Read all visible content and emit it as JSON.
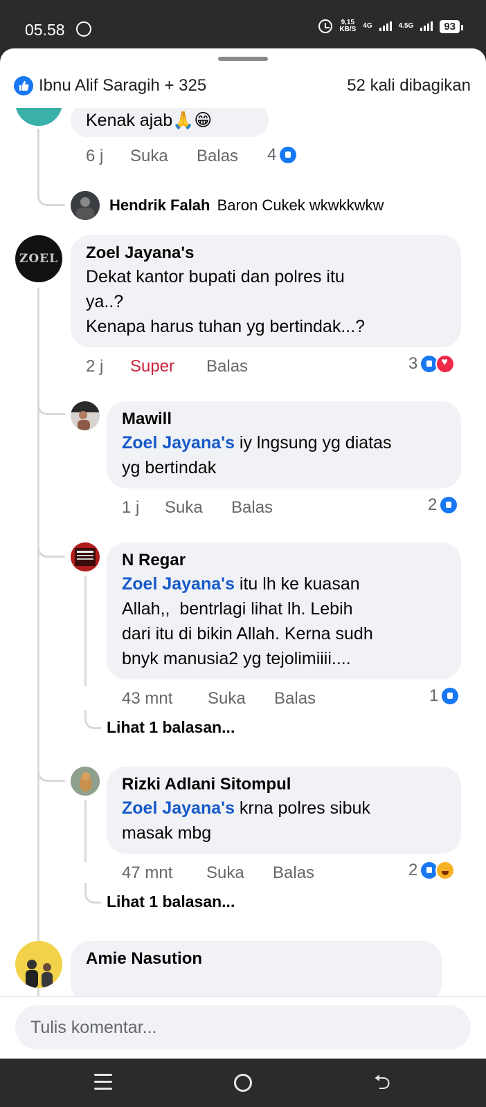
{
  "status_bar": {
    "time": "05.58",
    "net_speed_value": "9,15",
    "net_speed_unit": "KB/S",
    "sim1": "4G",
    "sim2": "4.5G",
    "battery": "93"
  },
  "sheet": {
    "reactors": "Ibnu Alif Saragih + 325",
    "shares": "52 kali dibagikan"
  },
  "comments": [
    {
      "id": "c0",
      "text": "Kenak ajab🙏😁",
      "time": "6 j",
      "like_label": "Suka",
      "reply_label": "Balas",
      "reaction_count": "4"
    },
    {
      "id": "c0-reply",
      "author": "Hendrik Falah",
      "text": "Baron Cukek wkwkkwkw"
    },
    {
      "id": "c1",
      "author": "Zoel Jayana's",
      "avatar_text": "ZOEL",
      "text_line1": "Dekat kantor bupati dan polres itu",
      "text_line2": "ya..?",
      "text_line3": "Kenapa harus tuhan yg bertindak...?",
      "time": "2 j",
      "like_label": "Super",
      "reply_label": "Balas",
      "reaction_count": "3"
    },
    {
      "id": "c1-r1",
      "author": "Mawill",
      "mention": "Zoel Jayana's",
      "text_after_mention": " iy lngsung yg diatas",
      "text_line2": "yg bertindak",
      "time": "1 j",
      "like_label": "Suka",
      "reply_label": "Balas",
      "reaction_count": "2"
    },
    {
      "id": "c1-r2",
      "author": "N Regar",
      "mention": "Zoel Jayana's",
      "text_after_mention": " itu lh ke kuasan",
      "text_line2": "Allah,,  bentrlagi lihat lh. Lebih",
      "text_line3": "dari itu di bikin Allah. Kerna sudh",
      "text_line4": "bnyk manusia2 yg tejolimiiii....",
      "time": "43 mnt",
      "like_label": "Suka",
      "reply_label": "Balas",
      "reaction_count": "1",
      "see_more": "Lihat 1 balasan..."
    },
    {
      "id": "c1-r3",
      "author": "Rizki Adlani Sitompul",
      "mention": "Zoel Jayana's",
      "text_after_mention": " krna polres sibuk",
      "text_line2": "masak mbg",
      "time": "47 mnt",
      "like_label": "Suka",
      "reply_label": "Balas",
      "reaction_count": "2",
      "see_more": "Lihat 1 balasan..."
    },
    {
      "id": "c2",
      "author": "Amie Nasution"
    }
  ],
  "composer": {
    "placeholder": "Tulis komentar..."
  },
  "colors": {
    "like_blue": "#1877f2",
    "super_red": "#c9243b",
    "mention_blue": "#1659c9",
    "bubble_gray": "#f0f2f5"
  }
}
